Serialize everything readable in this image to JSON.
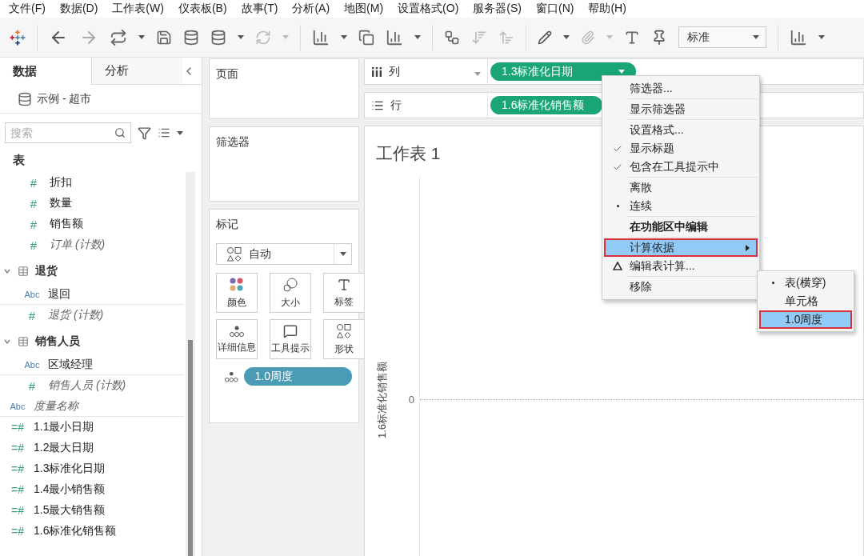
{
  "menu_bar": [
    "文件(F)",
    "数据(D)",
    "工作表(W)",
    "仪表板(B)",
    "故事(T)",
    "分析(A)",
    "地图(M)",
    "设置格式(O)",
    "服务器(S)",
    "窗口(N)",
    "帮助(H)"
  ],
  "toolbar": {
    "fit_select": "标准"
  },
  "data_pane": {
    "tabs": [
      {
        "label": "数据",
        "selected": true
      },
      {
        "label": "分析",
        "selected": false
      }
    ],
    "datasource": "示例 - 超市",
    "search": {
      "placeholder": "搜索"
    },
    "items": [
      {
        "kind": "heading",
        "label": "表"
      },
      {
        "kind": "measure",
        "icon": "#",
        "label": "折扣",
        "italic": false
      },
      {
        "kind": "measure",
        "icon": "#",
        "label": "数量",
        "italic": false
      },
      {
        "kind": "measure",
        "icon": "#",
        "label": "销售额",
        "italic": false
      },
      {
        "kind": "measure",
        "icon": "#",
        "label": "订单 (计数)",
        "italic": true
      },
      {
        "kind": "table",
        "label": "退货",
        "expanded": true,
        "children": [
          {
            "kind": "dimension",
            "icon": "Abc",
            "label": "退回",
            "italic": false
          },
          {
            "kind": "measure",
            "icon": "#",
            "label": "退货 (计数)",
            "italic": true
          }
        ]
      },
      {
        "kind": "table",
        "label": "销售人员",
        "expanded": true,
        "children": [
          {
            "kind": "dimension",
            "icon": "Abc",
            "label": "区域经理",
            "italic": false
          },
          {
            "kind": "measure",
            "icon": "#",
            "label": "销售人员 (计数)",
            "italic": true
          }
        ]
      },
      {
        "kind": "dimension",
        "icon": "Abc",
        "label": "度量名称",
        "italic": true
      },
      {
        "kind": "calc",
        "icon": "=#",
        "label": "1.1最小日期",
        "italic": false
      },
      {
        "kind": "calc",
        "icon": "=#",
        "label": "1.2最大日期",
        "italic": false
      },
      {
        "kind": "calc",
        "icon": "=#",
        "label": "1.3标准化日期",
        "italic": false
      },
      {
        "kind": "calc",
        "icon": "=#",
        "label": "1.4最小销售额",
        "italic": false
      },
      {
        "kind": "calc",
        "icon": "=#",
        "label": "1.5最大销售额",
        "italic": false
      },
      {
        "kind": "calc",
        "icon": "=#",
        "label": "1.6标准化销售额",
        "italic": false
      }
    ]
  },
  "cards": {
    "pages": {
      "title": "页面"
    },
    "filters": {
      "title": "筛选器"
    },
    "marks": {
      "title": "标记",
      "mark_type": "自动",
      "buttons": [
        "颜色",
        "大小",
        "标签",
        "详细信息",
        "工具提示",
        "形状"
      ],
      "pills": [
        {
          "label": "1.0周度"
        }
      ]
    }
  },
  "shelves": [
    {
      "kind": "columns",
      "label": "列",
      "pill": "1.3标准化日期"
    },
    {
      "kind": "rows",
      "label": "行",
      "pill": "1.6标准化销售额"
    }
  ],
  "view": {
    "title": "工作表 1",
    "axis_label": "1.6标准化销售额",
    "tick": "0"
  },
  "context_menu": {
    "groups": [
      {
        "items": [
          {
            "label": "筛选器..."
          }
        ]
      },
      {
        "items": [
          {
            "label": "显示筛选器"
          }
        ]
      },
      {
        "items": [
          {
            "label": "设置格式..."
          },
          {
            "label": "显示标题",
            "checked": true
          },
          {
            "label": "包含在工具提示中",
            "checked": true
          }
        ]
      },
      {
        "items": [
          {
            "label": "离散",
            "selected": false
          },
          {
            "label": "连续",
            "selected": true
          }
        ]
      },
      {
        "items": [
          {
            "label": "在功能区中编辑",
            "bold": true
          }
        ]
      },
      {
        "items": [
          {
            "label": "计算依据",
            "highlighted": true,
            "submenu": true
          },
          {
            "label": "编辑表计算...",
            "table_calc": true
          }
        ]
      },
      {
        "items": [
          {
            "label": "移除"
          }
        ]
      }
    ],
    "submenu": {
      "items": [
        {
          "label": "表(横穿)",
          "selected": true
        },
        {
          "label": "单元格",
          "selected": false
        },
        {
          "label": "1.0周度",
          "selected": false,
          "highlighted": true
        }
      ]
    }
  }
}
